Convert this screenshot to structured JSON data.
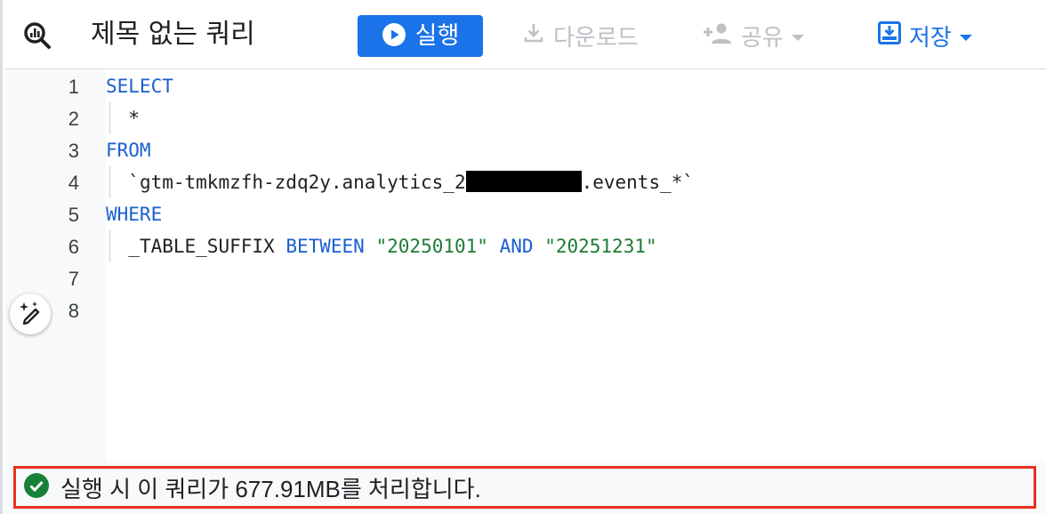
{
  "toolbar": {
    "title": "제목 없는 쿼리",
    "run_label": "실행",
    "download_label": "다운로드",
    "share_label": "공유",
    "save_label": "저장"
  },
  "editor": {
    "line_numbers": [
      "1",
      "2",
      "3",
      "4",
      "5",
      "6",
      "7",
      "8"
    ],
    "lines": {
      "l1_kw": "SELECT",
      "l2_text": "*",
      "l3_kw": "FROM",
      "l4_prefix": "`gtm-tmkmzfh-zdq2y.analytics_2",
      "l4_suffix": ".events_*`",
      "l5_kw": "WHERE",
      "l6_ident": "_TABLE_SUFFIX",
      "l6_kw1": "BETWEEN",
      "l6_str1": "\"20250101\"",
      "l6_kw2": "AND",
      "l6_str2": "\"20251231\""
    }
  },
  "status": {
    "message": "실행 시 이 쿼리가 677.91MB를 처리합니다."
  },
  "icons": {
    "query": "query-icon",
    "play": "play-icon",
    "download": "download-icon",
    "share": "person-add-icon",
    "save": "save-icon",
    "ai": "pen-sparkle-icon",
    "check": "check-circle-icon"
  },
  "colors": {
    "accent": "#1a73e8",
    "keyword": "#1a5fd0",
    "string": "#1e7b34",
    "success": "#188038",
    "highlight": "#e8321f"
  }
}
